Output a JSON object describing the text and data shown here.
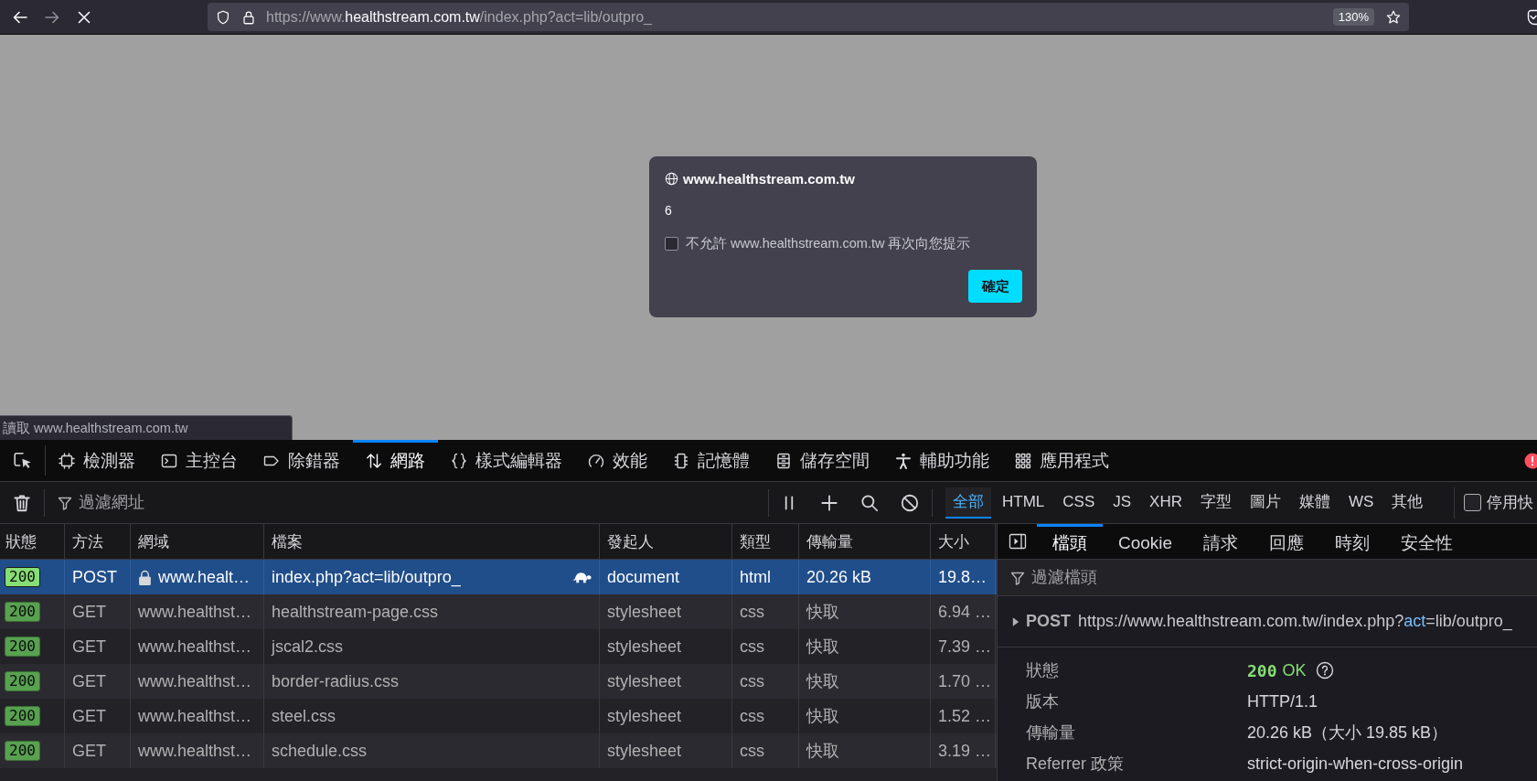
{
  "browser": {
    "nav": [
      {
        "kind": "back",
        "disabled": false
      },
      {
        "kind": "forward",
        "disabled": true
      },
      {
        "kind": "stop",
        "disabled": false
      }
    ],
    "url": "https://www.**healthstream.com.tw**/index.php?act=lib/outpro_",
    "zoom": "130%"
  },
  "dialog": {
    "origin": "www.healthstream.com.tw",
    "message": "6",
    "checkbox": {
      "label": "不允許 www.healthstream.com.tw 再次向您提示",
      "checked": false
    },
    "button": "確定"
  },
  "status_tooltip": "讀取 www.healthstream.com.tw",
  "devtools": {
    "tabs": [
      {
        "kind": "inspector",
        "label": "檢測器",
        "selected": false
      },
      {
        "kind": "console",
        "label": "主控台",
        "selected": false
      },
      {
        "kind": "debugger",
        "label": "除錯器",
        "selected": false
      },
      {
        "kind": "network",
        "label": "網路",
        "selected": true
      },
      {
        "kind": "style_editor",
        "label": "樣式編輯器",
        "selected": false
      },
      {
        "kind": "performance",
        "label": "效能",
        "selected": false
      },
      {
        "kind": "memory",
        "label": "記憶體",
        "selected": false
      },
      {
        "kind": "storage",
        "label": "儲存空間",
        "selected": false
      },
      {
        "kind": "accessibility",
        "label": "輔助功能",
        "selected": false
      },
      {
        "kind": "application",
        "label": "應用程式",
        "selected": false
      }
    ],
    "network_toolbar": {
      "filter": {
        "placeholder": "過濾網址"
      },
      "type_filters": [
        {
          "label": "全部",
          "selected": true
        },
        {
          "label": "HTML",
          "selected": false
        },
        {
          "label": "CSS",
          "selected": false
        },
        {
          "label": "JS",
          "selected": false
        },
        {
          "label": "XHR",
          "selected": false
        },
        {
          "label": "字型",
          "selected": false
        },
        {
          "label": "圖片",
          "selected": false
        },
        {
          "label": "媒體",
          "selected": false
        },
        {
          "label": "WS",
          "selected": false
        },
        {
          "label": "其他",
          "selected": false
        }
      ],
      "disable_cache": {
        "label": "停用快",
        "checked": false
      }
    },
    "table": {
      "columns": [
        "狀態",
        "方法",
        "網域",
        "檔案",
        "發起人",
        "類型",
        "傳輸量",
        "大小"
      ],
      "rows": [
        {
          "status": "200",
          "method": "POST",
          "secure": true,
          "domain": "www.healt…",
          "file": "index.php?act=lib/outpro_",
          "slow": true,
          "initiator": "document",
          "type": "html",
          "transferred": "20.26 kB",
          "size": "19.8…",
          "selected": true
        },
        {
          "status": "200",
          "method": "GET",
          "secure": false,
          "domain": "www.healthst…",
          "file": "healthstream-page.css",
          "slow": false,
          "initiator": "stylesheet",
          "type": "css",
          "transferred": "快取",
          "size": "6.94 …",
          "selected": false
        },
        {
          "status": "200",
          "method": "GET",
          "secure": false,
          "domain": "www.healthst…",
          "file": "jscal2.css",
          "slow": false,
          "initiator": "stylesheet",
          "type": "css",
          "transferred": "快取",
          "size": "7.39 …",
          "selected": false
        },
        {
          "status": "200",
          "method": "GET",
          "secure": false,
          "domain": "www.healthst…",
          "file": "border-radius.css",
          "slow": false,
          "initiator": "stylesheet",
          "type": "css",
          "transferred": "快取",
          "size": "1.70 …",
          "selected": false
        },
        {
          "status": "200",
          "method": "GET",
          "secure": false,
          "domain": "www.healthst…",
          "file": "steel.css",
          "slow": false,
          "initiator": "stylesheet",
          "type": "css",
          "transferred": "快取",
          "size": "1.52 …",
          "selected": false
        },
        {
          "status": "200",
          "method": "GET",
          "secure": false,
          "domain": "www.healthst…",
          "file": "schedule.css",
          "slow": false,
          "initiator": "stylesheet",
          "type": "css",
          "transferred": "快取",
          "size": "3.19 …",
          "selected": false
        }
      ]
    },
    "sidebar": {
      "tabs": [
        {
          "label": "檔頭",
          "selected": true
        },
        {
          "label": "Cookie",
          "selected": false
        },
        {
          "label": "請求",
          "selected": false
        },
        {
          "label": "回應",
          "selected": false
        },
        {
          "label": "時刻",
          "selected": false
        },
        {
          "label": "安全性",
          "selected": false
        }
      ],
      "filter": {
        "placeholder": "過濾檔頭"
      },
      "request": {
        "method": "POST",
        "url": "https://www.healthstream.com.tw/index.php?**act**=lib/outpro_",
        "expanded": false
      },
      "fields": [
        {
          "kind": "status",
          "label": "狀態",
          "code": "200",
          "value": "OK"
        },
        {
          "kind": "text",
          "label": "版本",
          "value": "HTTP/1.1"
        },
        {
          "kind": "text",
          "label": "傳輸量",
          "value": "20.26 kB（大小 19.85 kB）"
        },
        {
          "kind": "text",
          "label": "Referrer 政策",
          "value": "strict-origin-when-cross-origin"
        }
      ]
    }
  }
}
